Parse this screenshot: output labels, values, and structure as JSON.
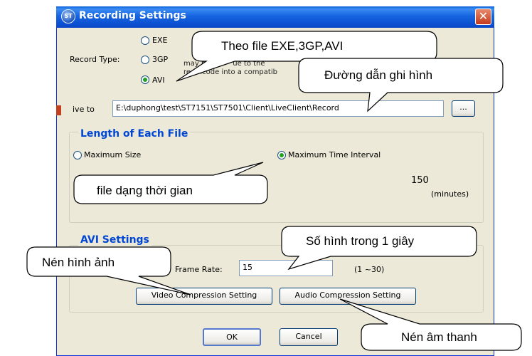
{
  "window": {
    "title": "Recording Settings"
  },
  "record_type": {
    "label": "Record Type:",
    "options": [
      "EXE",
      "3GP",
      "AVI"
    ],
    "selected": "AVI",
    "description_visible": "may be ... ue to the ... re-encode into a compatib..."
  },
  "save": {
    "label": "ive to",
    "path": "E:\\duphong\\test\\ST7151\\ST7501\\Client\\LiveClient\\Record",
    "browse_label": "..."
  },
  "length": {
    "title": "Length of Each File",
    "option_size": "Maximum Size",
    "option_time": "Maximum Time Interval",
    "selected": "Maximum Time Interval",
    "time_value": "150",
    "time_unit": "(minutes)"
  },
  "avi": {
    "title": "AVI Settings",
    "frame_rate_label": "Frame Rate:",
    "frame_rate_value": "15",
    "frame_rate_range": "(1 ~30)",
    "video_button": "Video Compression Setting",
    "audio_button": "Audio Compression Setting"
  },
  "footer": {
    "ok": "OK",
    "cancel": "Cancel"
  },
  "callouts": {
    "file_types": "Theo file EXE,3GP,AVI",
    "save_path": "Đường dẫn ghi hình",
    "time_file": "file dạng thời gian",
    "frames_per_second": "Số hình trong 1 giây",
    "image_compress": "Nén hình ảnh",
    "audio_compress": "Nén âm thanh"
  },
  "colors": {
    "titlebar": "#0a5fd8",
    "group_title": "#0046d5",
    "dialog_bg": "#ece9d8"
  }
}
